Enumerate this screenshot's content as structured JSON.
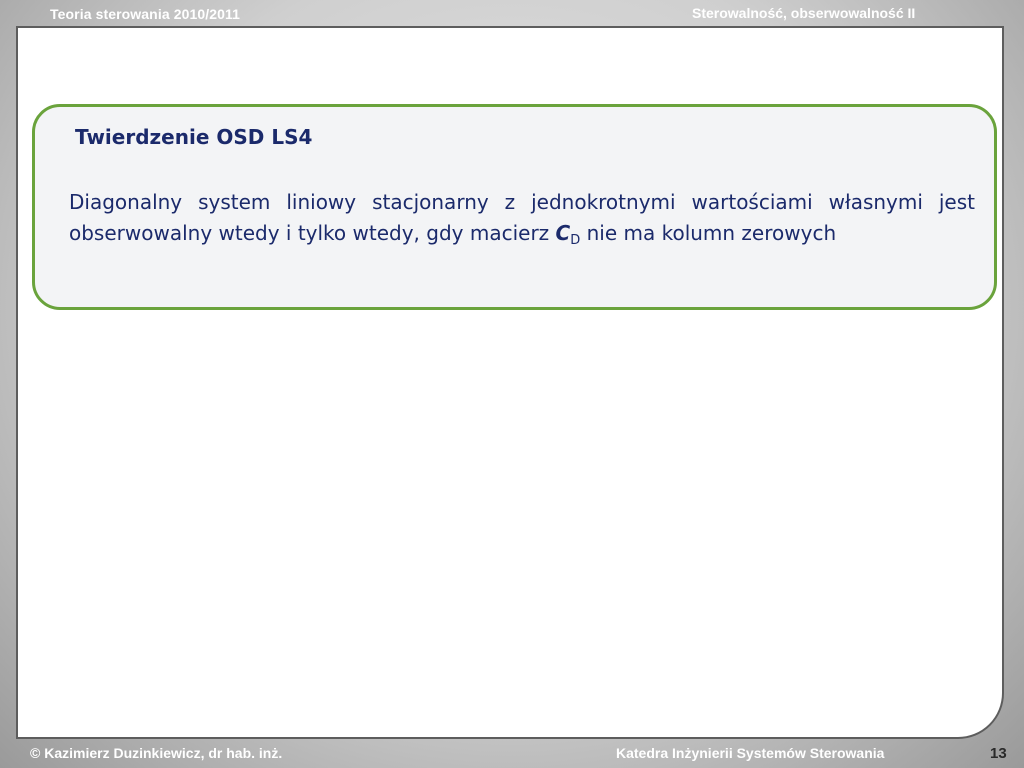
{
  "header": {
    "course": "Teoria sterowania 2010/2011",
    "topic": "Sterowalność, obserwowalność II"
  },
  "theorem": {
    "title": "Twierdzenie OSD LS4",
    "body_before": "Diagonalny system liniowy stacjonarny z jednokrotnymi wartościami własnymi jest obserwowalny wtedy i tylko wtedy, gdy macierz ",
    "matrix_symbol": "C",
    "matrix_subscript": "D",
    "body_after": " nie ma kolumn zerowych"
  },
  "footer": {
    "author": "© Kazimierz Duzinkiewicz, dr hab. inż.",
    "department": "Katedra Inżynierii Systemów Sterowania",
    "page_number": "13"
  },
  "colors": {
    "theorem_border": "#6aa33c",
    "theorem_background": "#f3f4f6",
    "theorem_text": "#1b2a6b",
    "frame_border": "#5d5d5d"
  }
}
